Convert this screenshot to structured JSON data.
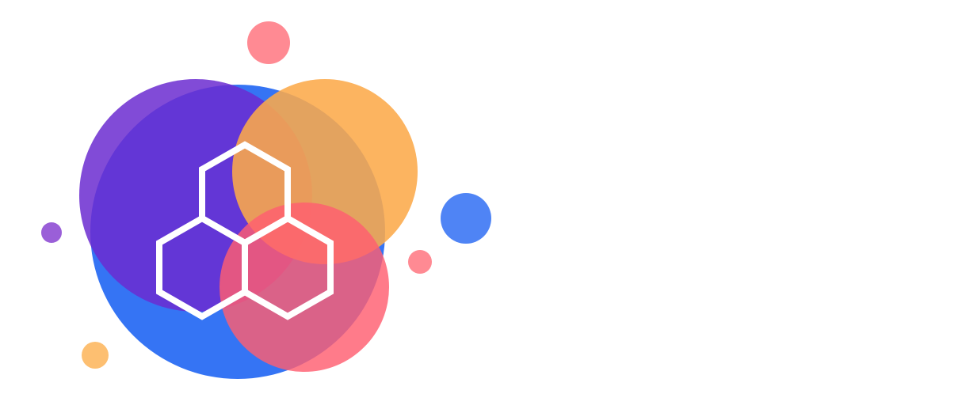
{
  "logo": {
    "colors": {
      "background": "#ffffff",
      "blue": "#3574f4",
      "purple": "#6b2bd0",
      "orange": "#fcaa4a",
      "coral": "#ff5e70",
      "dot_pink": "#ff8a93",
      "dot_purple": "#9a5fd8",
      "dot_blue": "#4f84f5",
      "dot_orange": "#fdbf71",
      "hexagon_stroke": "#ffffff"
    },
    "icon": "hexagon-cluster-icon"
  }
}
